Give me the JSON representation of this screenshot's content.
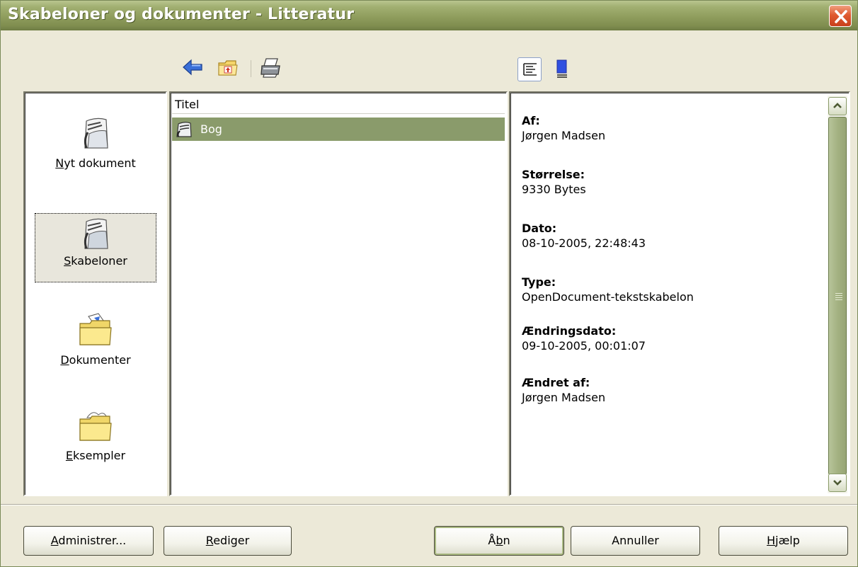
{
  "window": {
    "title": "Skabeloner og dokumenter - Litteratur",
    "close_icon": "close-icon"
  },
  "toolbar": {
    "icons": [
      "back-arrow-icon",
      "folder-up-icon",
      "print-icon"
    ],
    "view_icons": [
      "document-properties-icon",
      "document-preview-icon"
    ],
    "active_view": "document-properties"
  },
  "nav": {
    "items": [
      {
        "label_pre": "",
        "label_ul": "N",
        "label_post": "yt dokument",
        "icon": "new-document-icon"
      },
      {
        "label_pre": "",
        "label_ul": "S",
        "label_post": "kabeloner",
        "icon": "templates-icon",
        "selected": true
      },
      {
        "label_pre": "",
        "label_ul": "D",
        "label_post": "okumenter",
        "icon": "documents-folder-icon"
      },
      {
        "label_pre": "",
        "label_ul": "E",
        "label_post": "ksempler",
        "icon": "examples-folder-icon"
      }
    ]
  },
  "list": {
    "header": "Titel",
    "items": [
      {
        "label": "Bog",
        "icon": "template-folder-icon",
        "selected": true
      }
    ]
  },
  "properties": [
    {
      "key": "Af:",
      "value": "Jørgen Madsen"
    },
    {
      "key": "Størrelse:",
      "value": "9330 Bytes"
    },
    {
      "key": "Dato:",
      "value": "08-10-2005, 22:48:43"
    },
    {
      "key": "Type:",
      "value": "OpenDocument-tekstskabelon"
    },
    {
      "key": "Ændringsdato:",
      "value": "09-10-2005, 00:01:07"
    },
    {
      "key": "Ændret af:",
      "value": "Jørgen Madsen"
    }
  ],
  "buttons": {
    "manage": {
      "pre": "",
      "ul": "A",
      "post": "dministrer..."
    },
    "edit": {
      "pre": "",
      "ul": "R",
      "post": "ediger"
    },
    "open": {
      "pre": "Å",
      "ul": "b",
      "post": "n"
    },
    "cancel": {
      "pre": "Annuller",
      "ul": "",
      "post": ""
    },
    "help": {
      "pre": "",
      "ul": "H",
      "post": "jælp"
    }
  },
  "colors": {
    "titlebar": "#8f9d5d",
    "selection": "#8a9b6b",
    "dialog_bg": "#ece9d8"
  }
}
